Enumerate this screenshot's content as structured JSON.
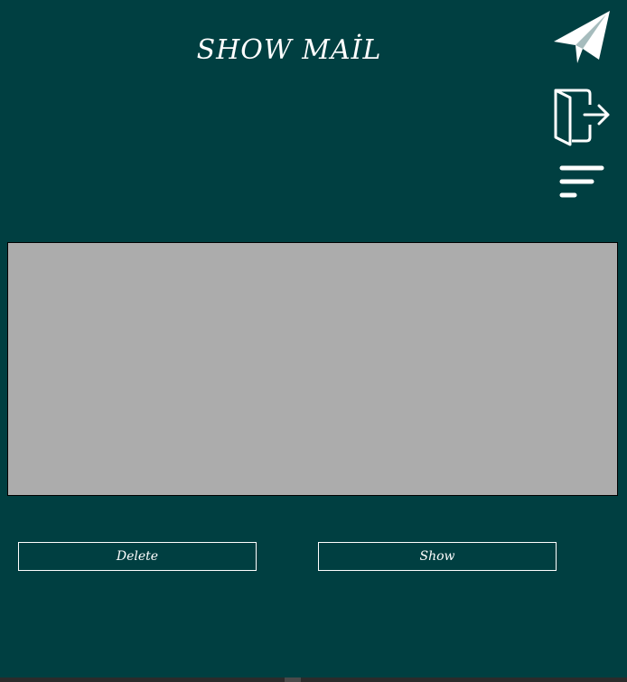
{
  "header": {
    "title": "SHOW MAİL"
  },
  "toolbar": {
    "icons": [
      "send-icon",
      "logout-icon",
      "filter-icon"
    ]
  },
  "actions": {
    "delete_label": "Delete",
    "show_label": "Show"
  },
  "colors": {
    "background": "#003f41",
    "panel": "#acacac",
    "text": "#ffffff"
  }
}
